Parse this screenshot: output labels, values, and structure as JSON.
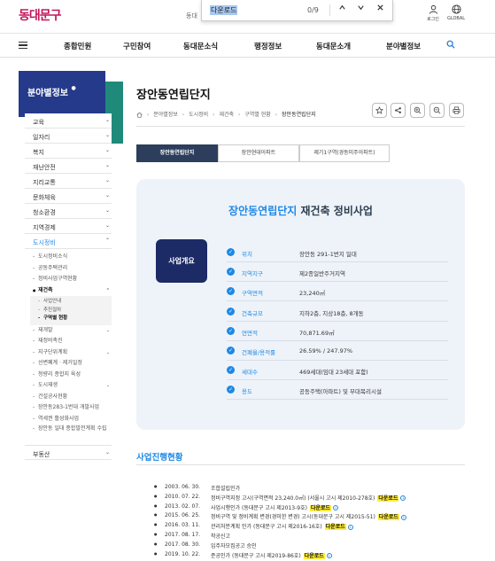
{
  "header": {
    "logo": "동대문구",
    "partial_text": "동대",
    "utility": [
      {
        "label": "로그인",
        "icon": "user-icon"
      },
      {
        "label": "GLOBAL",
        "icon": "globe-icon"
      }
    ]
  },
  "find_bar": {
    "query": "다운로드",
    "count": "0/9"
  },
  "gnb": {
    "items": [
      "종합민원",
      "구민참여",
      "동대문소식",
      "행정정보",
      "동대문소개",
      "분야별정보"
    ]
  },
  "sidebar": {
    "title": "분야별정보",
    "items": [
      {
        "label": "교육"
      },
      {
        "label": "일자리"
      },
      {
        "label": "복지"
      },
      {
        "label": "재난안전"
      },
      {
        "label": "지리교통"
      },
      {
        "label": "문화체육"
      },
      {
        "label": "청소환경"
      },
      {
        "label": "지역경제"
      },
      {
        "label": "도시정비"
      }
    ],
    "sub_items": [
      "도시정비소식",
      "공동주택관리",
      "정비사업구역현황",
      "재건축"
    ],
    "subsub_items": [
      "사업안내",
      "추진절차",
      "구역별 현황"
    ],
    "sub_items_after": [
      "재개발",
      "재정비촉진",
      "지구단위계획",
      "선변폐계 · 제거일정",
      "청량리 종합지 육성",
      "도시재생",
      "건설공사현황",
      "장안동283-1번대 개발사업",
      "역세권 활성화사업",
      "장안동 일대 종합발전계획 수립"
    ],
    "last_item": "부동산"
  },
  "page": {
    "title": "장안동연립단지",
    "breadcrumb": [
      "분야별정보",
      "도시정비",
      "재건축",
      "구역별 현황",
      "장안동연립단지"
    ]
  },
  "tabs": [
    "장안동연립단지",
    "장안현대아파트",
    "제기1구역(경동미주아파트)"
  ],
  "info": {
    "title_highlight": "장안동연립단지",
    "title_rest": " 재건축 정비사업",
    "badge": "사업개요",
    "rows": [
      {
        "label": "위치",
        "value": "장안동 291-1번지 일대"
      },
      {
        "label": "지역지구",
        "value": "제2종일반주거지역"
      },
      {
        "label": "구역면적",
        "value": "23,240㎡"
      },
      {
        "label": "건축규모",
        "value": "지하2층, 지상18층, 8개동"
      },
      {
        "label": "연면적",
        "value": "70,871.69㎡"
      },
      {
        "label": "건폐율/용적률",
        "value": "26.59% / 247.97%"
      },
      {
        "label": "세대수",
        "value": "469세대(임대 23세대 포함)"
      },
      {
        "label": "용도",
        "value": "공동주택(아파트) 및 부대복리시설"
      }
    ]
  },
  "progress": {
    "title": "사업진행현황",
    "download_label": "다운로드",
    "rows": [
      {
        "date": "2003. 06. 30.",
        "desc": "조합설립인가",
        "download": false
      },
      {
        "date": "2010. 07. 22.",
        "desc": "정비구역지정 고시(구역면적 23,240.0㎡) (서울시 고시 제2010-278호)",
        "download": true
      },
      {
        "date": "2013. 02. 07.",
        "desc": "사업시행인가 (동대문구 고시 제2013-9호)",
        "download": true
      },
      {
        "date": "2015. 06. 25.",
        "desc": "정비구역 및 정비계획 변경(경미한 변경) 고시(동대문구 고시 제2015-51)",
        "download": true
      },
      {
        "date": "2016. 03. 11.",
        "desc": "관리처분계획 인가 (동대문구 고시 제2016-16호)",
        "download": true
      },
      {
        "date": "2017. 08. 17.",
        "desc": "착공신고",
        "download": false
      },
      {
        "date": "2017. 08. 30.",
        "desc": "입주자모집공고 승인",
        "download": false
      },
      {
        "date": "2019. 10. 22.",
        "desc": "준공인가 (동대문구 고시 제2019-86호)",
        "download": true
      }
    ]
  }
}
